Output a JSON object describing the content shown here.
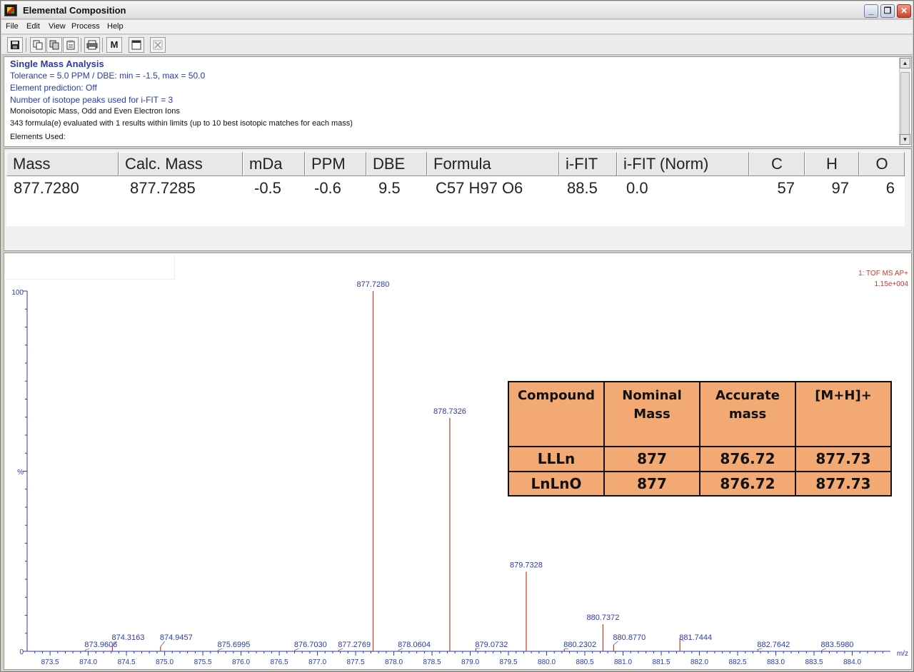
{
  "window": {
    "title": "Elemental Composition",
    "controls": [
      "_",
      "❐",
      "✕"
    ]
  },
  "menu": [
    "File",
    "Edit",
    "View",
    "Process",
    "Help"
  ],
  "toolbar": {
    "buttons": [
      "save-icon",
      "copy-icon",
      "copy-icon-2",
      "paste-icon",
      "print-icon",
      "m-icon",
      "window-icon",
      "close-x-icon"
    ],
    "m_label": "M"
  },
  "info": {
    "title": "Single Mass Analysis",
    "tolerance": "Tolerance = 5.0 PPM   /   DBE: min = -1.5, max = 50.0",
    "element_prediction": "Element prediction: Off",
    "isotope_peaks": "Number of isotope peaks used for i-FIT = 3",
    "ion_type": "Monoisotopic Mass, Odd and Even Electron Ions",
    "evaluated": "343 formula(e) evaluated with 1 results within limits (up to 10 best isotopic matches for each mass)",
    "elements_used": "Elements Used:"
  },
  "results_table": {
    "headers": [
      "Mass",
      "Calc. Mass",
      "mDa",
      "PPM",
      "DBE",
      "Formula",
      "i-FIT",
      "i-FIT (Norm)",
      "C",
      "H",
      "O"
    ],
    "row": [
      "877.7280",
      "877.7285",
      "-0.5",
      "-0.6",
      "9.5",
      "C57  H97  O6",
      "88.5",
      "0.0",
      "57",
      "97",
      "6"
    ]
  },
  "spectrum": {
    "instrument": "1: TOF MS AP+",
    "intensity": "1.15e+004",
    "y_axis": {
      "top_label": "100",
      "mid_label": "%",
      "bottom_label": "0"
    },
    "x_axis_unit": "m/z"
  },
  "chart_data": {
    "type": "bar",
    "xlabel": "m/z",
    "ylabel": "%",
    "xlim": [
      873.2,
      884.5
    ],
    "ylim": [
      0,
      100
    ],
    "x_ticks": [
      "873.5",
      "874.0",
      "874.5",
      "875.0",
      "875.5",
      "876.0",
      "876.5",
      "877.0",
      "877.5",
      "878.0",
      "878.5",
      "879.0",
      "879.5",
      "880.0",
      "880.5",
      "881.0",
      "881.5",
      "882.0",
      "882.5",
      "883.0",
      "883.5",
      "884.0"
    ],
    "peaks": [
      {
        "x": 873.9606,
        "y": 0.3,
        "label": "873.9606"
      },
      {
        "x": 874.3163,
        "y": 1.3,
        "label": "874.3163"
      },
      {
        "x": 874.9457,
        "y": 1.3,
        "label": "874.9457"
      },
      {
        "x": 875.6995,
        "y": 0.3,
        "label": "875.6995"
      },
      {
        "x": 876.703,
        "y": 0.3,
        "label": "876.7030"
      },
      {
        "x": 877.2769,
        "y": 0.3,
        "label": "877.2769"
      },
      {
        "x": 877.728,
        "y": 100,
        "label": "877.7280"
      },
      {
        "x": 878.0604,
        "y": 0.3,
        "label": "878.0604"
      },
      {
        "x": 878.7326,
        "y": 64.8,
        "label": "878.7326"
      },
      {
        "x": 879.0732,
        "y": 0.8,
        "label": "879.0732"
      },
      {
        "x": 879.7328,
        "y": 22.1,
        "label": "879.7328"
      },
      {
        "x": 880.2302,
        "y": 0.6,
        "label": "880.2302"
      },
      {
        "x": 880.7372,
        "y": 7.5,
        "label": "880.7372"
      },
      {
        "x": 880.877,
        "y": 1.8,
        "label": "880.8770"
      },
      {
        "x": 881.7444,
        "y": 3.5,
        "label": "881.7444"
      },
      {
        "x": 882.7642,
        "y": 0.5,
        "label": "882.7642"
      },
      {
        "x": 883.598,
        "y": 0.2,
        "label": "883.5980"
      }
    ]
  },
  "reference_table": {
    "headers": [
      "Compound",
      "Nominal Mass",
      "Accurate mass",
      "[M+H]+"
    ],
    "rows": [
      [
        "LLLn",
        "877",
        "876.72",
        "877.73"
      ],
      [
        "LnLnO",
        "877",
        "876.72",
        "877.73"
      ]
    ]
  }
}
